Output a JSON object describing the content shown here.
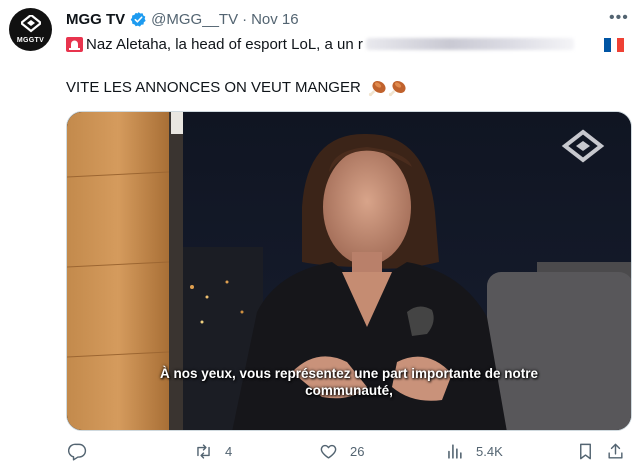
{
  "account": {
    "name": "MGG TV",
    "handle": "@MGG__TV",
    "separator": "·",
    "date": "Nov 16",
    "avatar_text": "MGGTV",
    "verified": true
  },
  "tweet": {
    "line1": "Naz Aletaha, la head of esport LoL, a un r",
    "line2": "VITE LES ANNONCES ON VEUT MANGER",
    "siren_emoji": "siren-icon",
    "drumstick_emojis": [
      "drumstick-icon",
      "drumstick-icon"
    ],
    "flag": "france-flag-icon"
  },
  "video": {
    "subtitle_line1": "À nos yeux, vous représentez une part importante de notre",
    "subtitle_line2": "communauté,",
    "watermark": "mgg-logo-icon"
  },
  "actions": {
    "reply": {
      "icon": "reply-icon",
      "count": ""
    },
    "retweet": {
      "icon": "retweet-icon",
      "count": "4"
    },
    "like": {
      "icon": "heart-icon",
      "count": "26"
    },
    "views": {
      "icon": "views-icon",
      "count": "5.4K"
    },
    "bookmark": {
      "icon": "bookmark-icon"
    },
    "share": {
      "icon": "share-icon"
    }
  },
  "colors": {
    "text": "#0f1419",
    "secondary": "#536471",
    "verified": "#1d9bf0",
    "flag_blue": "#0055a4",
    "flag_red": "#ef4135"
  }
}
